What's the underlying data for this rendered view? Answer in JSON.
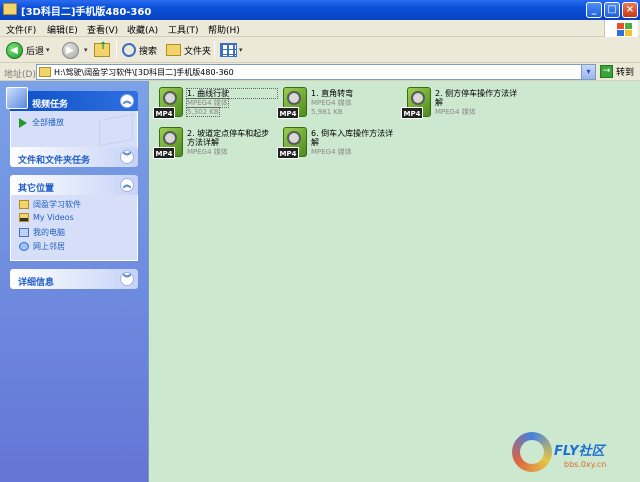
{
  "window": {
    "title": "[3D科目二]手机版480-360",
    "buttons": {
      "minimize": "_",
      "maximize": "□",
      "close": "×"
    }
  },
  "menu": [
    "文件(F)",
    "编辑(E)",
    "查看(V)",
    "收藏(A)",
    "工具(T)",
    "帮助(H)"
  ],
  "toolbar": {
    "back": "后退",
    "search": "搜索",
    "folders": "文件夹"
  },
  "address": {
    "label": "地址(D)",
    "value": "H:\\驾驶\\阔盈学习软件\\[3D科目二]手机版480-360",
    "go": "转到"
  },
  "left_pane": {
    "video_tasks": {
      "title": "视频任务",
      "items": [
        "全部播放"
      ]
    },
    "file_tasks": {
      "title": "文件和文件夹任务"
    },
    "other_places": {
      "title": "其它位置",
      "items": [
        "阔盈学习软件",
        "My Videos",
        "我的电脑",
        "网上邻居"
      ]
    },
    "details": {
      "title": "详细信息"
    }
  },
  "files": [
    {
      "name": "1. 曲线行驶",
      "type": "MPEG4 媒体",
      "size": "5,302 KB",
      "tag": "MP4"
    },
    {
      "name": "1. 直角转弯",
      "type": "MPEG4 媒体",
      "size": "5,981 KB",
      "tag": "MP4"
    },
    {
      "name": "2. 侧方停车操作方法详解",
      "type": "MPEG4 媒体",
      "tag": "MP4"
    },
    {
      "name": "2. 坡道定点停车和起步方法详解",
      "type": "MPEG4 媒体",
      "tag": "MP4"
    },
    {
      "name": "6. 倒车入库操作方法详解",
      "type": "MPEG4 媒体",
      "tag": "MP4"
    }
  ],
  "watermark": {
    "brand": "FLY社区",
    "url": "bbs.0xy.cn"
  }
}
